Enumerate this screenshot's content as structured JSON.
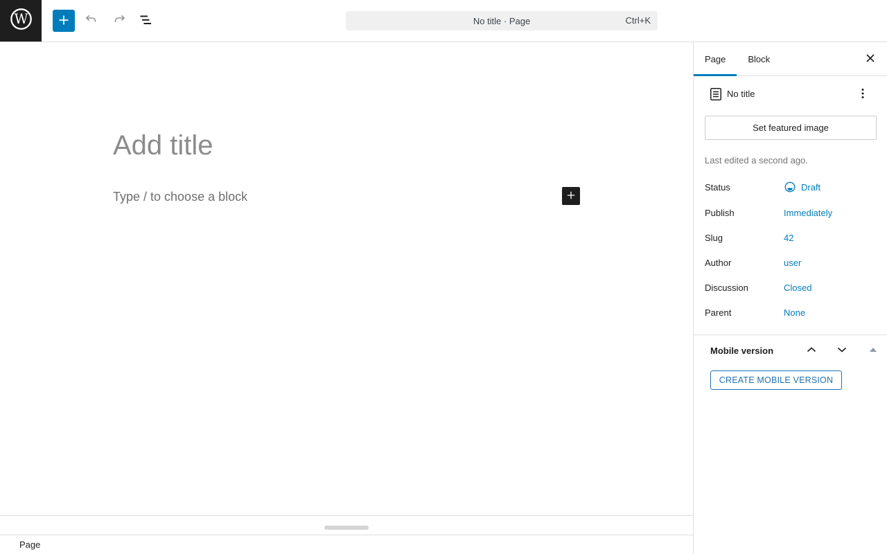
{
  "topbar": {
    "command_bar": {
      "title": "No title · Page",
      "shortcut": "Ctrl+K"
    }
  },
  "editor": {
    "title_placeholder": "Add title",
    "block_placeholder": "Type / to choose a block"
  },
  "footer": {
    "breadcrumb": "Page"
  },
  "sidebar": {
    "tabs": {
      "page": "Page",
      "block": "Block"
    },
    "document": {
      "title": "No title"
    },
    "featured_image_button_label": "Set featured image",
    "last_edited": "Last edited a second ago.",
    "rows": [
      {
        "label": "Status",
        "value": "Draft"
      },
      {
        "label": "Publish",
        "value": "Immediately"
      },
      {
        "label": "Slug",
        "value": "42"
      },
      {
        "label": "Author",
        "value": "user"
      },
      {
        "label": "Discussion",
        "value": "Closed"
      },
      {
        "label": "Parent",
        "value": "None"
      }
    ],
    "mobile_panel": {
      "title": "Mobile version",
      "button_label": "CREATE MOBILE VERSION"
    }
  },
  "colors": {
    "accent": "#007cba",
    "link_blue": "#2271b1",
    "toolbar_black": "#1e1e1e",
    "command_bar_bg": "#f0f0f0"
  }
}
